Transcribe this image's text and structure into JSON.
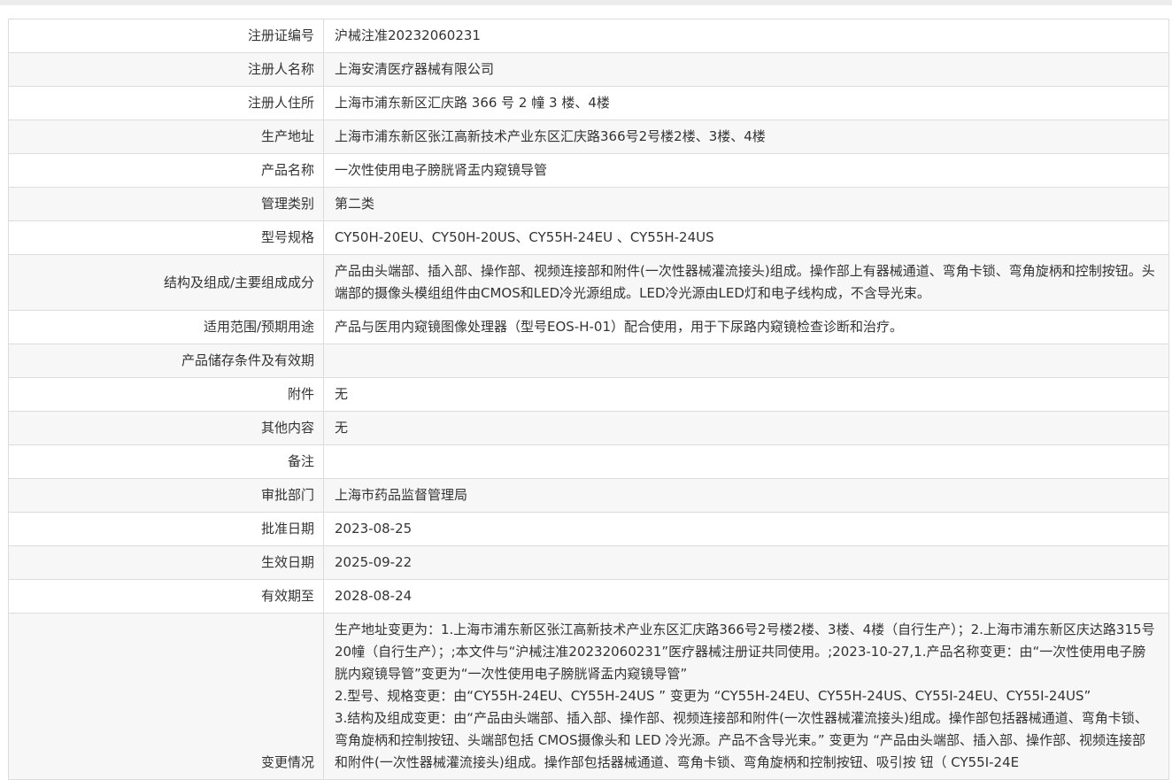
{
  "rows": [
    {
      "label": "注册证编号",
      "value": "沪械注准20232060231"
    },
    {
      "label": "注册人名称",
      "value": "上海安清医疗器械有限公司"
    },
    {
      "label": "注册人住所",
      "value": "上海市浦东新区汇庆路 366 号 2 幢 3 楼、4楼"
    },
    {
      "label": "生产地址",
      "value": "上海市浦东新区张江高新技术产业东区汇庆路366号2号楼2楼、3楼、4楼"
    },
    {
      "label": "产品名称",
      "value": "一次性使用电子膀胱肾盂内窥镜导管"
    },
    {
      "label": "管理类别",
      "value": "第二类"
    },
    {
      "label": "型号规格",
      "value": "CY50H-20EU、CY50H-20US、CY55H-24EU 、CY55H-24US"
    },
    {
      "label": "结构及组成/主要组成成分",
      "value": "产品由头端部、插入部、操作部、视频连接部和附件(一次性器械灌流接头)组成。操作部上有器械通道、弯角卡锁、弯角旋柄和控制按钮。头端部的摄像头模组组件由CMOS和LED冷光源组成。LED冷光源由LED灯和电子线构成，不含导光束。"
    },
    {
      "label": "适用范围/预期用途",
      "value": "产品与医用内窥镜图像处理器（型号EOS-H-01）配合使用，用于下尿路内窥镜检查诊断和治疗。"
    },
    {
      "label": "产品储存条件及有效期",
      "value": ""
    },
    {
      "label": "附件",
      "value": "无"
    },
    {
      "label": "其他内容",
      "value": "无"
    },
    {
      "label": "备注",
      "value": ""
    },
    {
      "label": "审批部门",
      "value": "上海市药品监督管理局"
    },
    {
      "label": "批准日期",
      "value": "2023-08-25"
    },
    {
      "label": "生效日期",
      "value": "2025-09-22"
    },
    {
      "label": "有效期至",
      "value": "2028-08-24"
    }
  ],
  "change": {
    "label": "变更情况",
    "lines": [
      "生产地址变更为：1.上海市浦东新区张江高新技术产业东区汇庆路366号2号楼2楼、3楼、4楼（自行生产）；2.上海市浦东新区庆达路315号20幢（自行生产）；;本文件与“沪械注准20232060231”医疗器械注册证共同使用。;2023-10-27,1.产品名称变更：由“一次性使用电子膀胱内窥镜导管”变更为“一次性使用电子膀胱肾盂内窥镜导管”",
      "2.型号、规格变更：由“CY55H-24EU、CY55H-24US ” 变更为 “CY55H-24EU、CY55H-24US、CY55I-24EU、CY55I-24US”",
      "3.结构及组成变更：由“产品由头端部、插入部、操作部、视频连接部和附件(一次性器械灌流接头)组成。操作部包括器械通道、弯角卡锁、弯角旋柄和控制按钮、头端部包括 CMOS摄像头和 LED 冷光源。产品不含导光束。” 变更为 “产品由头端部、插入部、操作部、视频连接部和附件(一次性器械灌流接头)组成。操作部包括器械通道、弯角卡锁、弯角旋柄和控制按钮、吸引按 钮（ CY55I-24E"
    ]
  }
}
